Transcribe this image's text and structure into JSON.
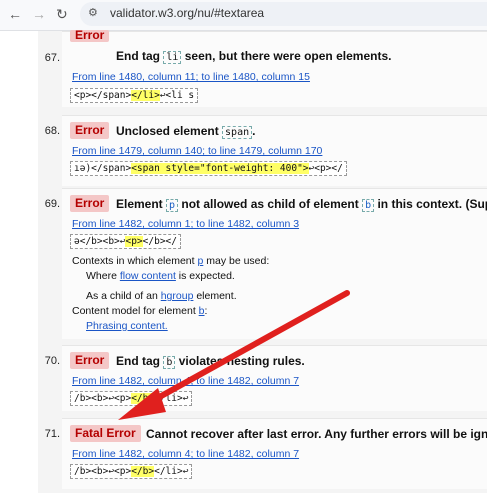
{
  "browser": {
    "url": "validator.w3.org/nu/#textarea",
    "back_icon": "←",
    "forward_icon": "→",
    "reload_icon": "↻",
    "site_icon": "⚙"
  },
  "errors": [
    {
      "number": "67.",
      "badge": "Error",
      "msg_a": "End tag ",
      "code1": "li",
      "msg_b": " seen, but there were open elements.",
      "location": "From line 1480, column 11; to line 1480, column 15",
      "ext_pre": "<p></span>",
      "ext_hl": "</li>",
      "ext_post": "↩<li s"
    },
    {
      "number": "68.",
      "badge": "Error",
      "msg_a": "Unclosed element ",
      "code1": "span",
      "msg_b": ".",
      "location": "From line 1479, column 140; to line 1479, column 170",
      "ext_pre": "ıə)</span>",
      "ext_hl": "<span style=\"font-weight: 400\">",
      "ext_post": "↩<p></"
    },
    {
      "number": "69.",
      "badge": "Error",
      "msg_a": "Element ",
      "code1": "p",
      "msg_b": " not allowed as child of element ",
      "code2": "b",
      "msg_c": " in this context. (Suppr",
      "location": "From line 1482, column 1; to line 1482, column 3",
      "ext_pre": "ə</b><b>↩",
      "ext_hl": "<p>",
      "ext_post": "</b></",
      "ctx_label_a": "Contexts in which element ",
      "ctx_code": "p",
      "ctx_label_b": " may be used:",
      "where_a": "Where ",
      "where_link": "flow content",
      "where_b": " is expected.",
      "child_a": "As a child of an ",
      "child_link": "hgroup",
      "child_b": " element.",
      "model_a": "Content model for element ",
      "model_code": "b",
      "model_b": ":",
      "phrasing": "Phrasing content."
    },
    {
      "number": "70.",
      "badge": "Error",
      "msg_a": "End tag ",
      "code1": "b",
      "msg_b": " violates nesting rules.",
      "location": "From line 1482, column 4; to line 1482, column 7",
      "ext_pre": "/b><b>↩<p>",
      "ext_hl": "</b>",
      "ext_post": "</li>↩"
    },
    {
      "number": "71.",
      "badge": "Fatal Error",
      "msg_a": "Cannot recover after last error. Any further errors will be ignore",
      "location": "From line 1482, column 4; to line 1482, column 7",
      "ext_pre": "/b><b>↩<p>",
      "ext_hl": "</b>",
      "ext_post": "</li>↩"
    }
  ],
  "arrow_color": "#e0201e"
}
